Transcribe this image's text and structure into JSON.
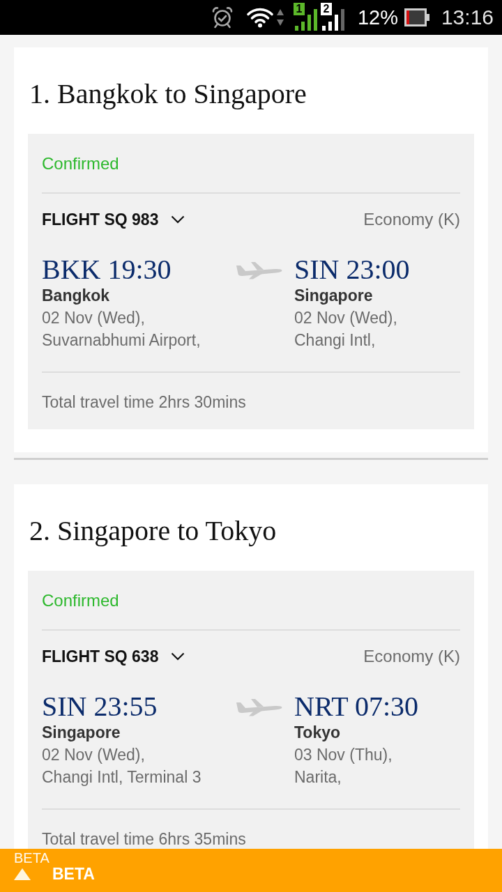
{
  "status_bar": {
    "sims": [
      {
        "label": "1",
        "active": true
      },
      {
        "label": "2",
        "active": false
      }
    ],
    "battery": "12%",
    "time": "13:16"
  },
  "trips": [
    {
      "title": "1. Bangkok to Singapore",
      "status": "Confirmed",
      "flight": "FLIGHT SQ 983",
      "expanded": false,
      "cabin": "Economy (K)",
      "depart": {
        "code_time": "BKK 19:30",
        "city": "Bangkok",
        "date": "02 Nov (Wed),",
        "airport": "Suvarnabhumi Airport,"
      },
      "arrive": {
        "code_time": "SIN 23:00",
        "city": "Singapore",
        "date": "02 Nov (Wed),",
        "airport": "Changi Intl,"
      },
      "total": "Total travel time 2hrs 30mins"
    },
    {
      "title": "2. Singapore to Tokyo",
      "status": "Confirmed",
      "flight": "FLIGHT SQ 638",
      "expanded": false,
      "cabin": "Economy (K)",
      "depart": {
        "code_time": "SIN 23:55",
        "city": "Singapore",
        "date": "02 Nov (Wed),",
        "airport": "Changi Intl, Terminal 3"
      },
      "arrive": {
        "code_time": "NRT 07:30",
        "city": "Tokyo",
        "date": "03 Nov (Thu),",
        "airport": "Narita,"
      },
      "total": "Total travel time 6hrs 35mins"
    }
  ],
  "beta_bar": {
    "ghost_label": "BETA",
    "label": "BETA",
    "expanded": false
  }
}
